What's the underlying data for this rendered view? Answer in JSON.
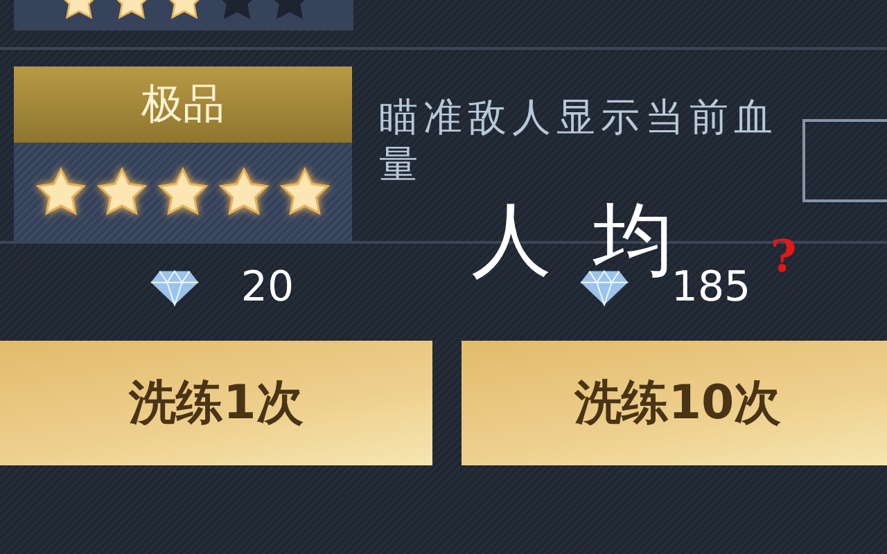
{
  "top_card": {
    "stars": 3
  },
  "attribute": {
    "grade": "极品",
    "stars": 5,
    "description": "瞄准敌人显示当前血量"
  },
  "costs": [
    {
      "amount": "20",
      "button": "洗练1次"
    },
    {
      "amount": "185",
      "button": "洗练10次"
    }
  ],
  "caption": {
    "text": "人均",
    "mark": "?"
  }
}
